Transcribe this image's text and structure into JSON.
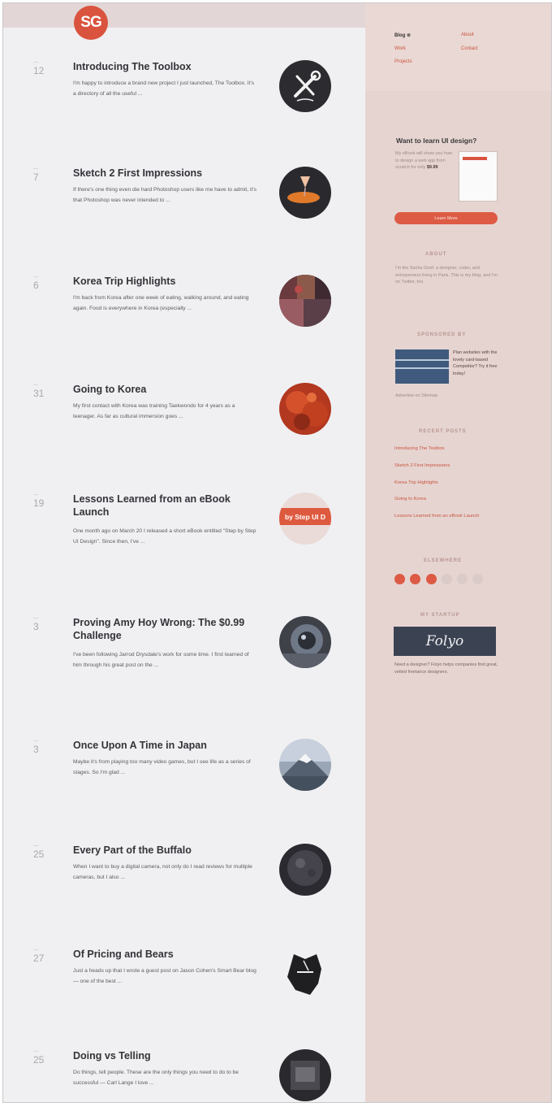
{
  "logo": {
    "text": "SG"
  },
  "posts": [
    {
      "day": "12",
      "title": "Introducing The Toolbox",
      "excerpt": "I'm happy to introduce a brand new project I just launched, The Toolbox. It's a directory of all the useful ..."
    },
    {
      "day": "7",
      "title": "Sketch 2 First Impressions",
      "excerpt": "If there's one thing even die hard Photoshop users like me have to admit, it's that Photoshop was never intended to ..."
    },
    {
      "day": "6",
      "title": "Korea Trip Highlights",
      "excerpt": "I'm back from Korea after one week of eating, walking around, and eating again. Food is everywhere in Korea (especially ..."
    },
    {
      "day": "31",
      "title": "Going to Korea",
      "excerpt": "My first contact with Korea was training Taekwondo for 4 years as a teenager. As far as cultural immersion goes ..."
    },
    {
      "day": "19",
      "title": "Lessons Learned from an eBook Launch",
      "excerpt": "One month ago on March 20 I released a short eBook entitled \"Step by Step UI Design\". Since then, I've ...",
      "thumb_text": "by Step UI D"
    },
    {
      "day": "3",
      "title": "Proving Amy Hoy Wrong: The $0.99 Challenge",
      "excerpt": "I've been following Jarrod Drysdale's work for some time. I first learned of him through his great post on the ..."
    },
    {
      "day": "3",
      "title": "Once Upon A Time in Japan",
      "excerpt": "Maybe it's from playing too many video games, but I see life as a series of stages. So I'm glad ..."
    },
    {
      "day": "25",
      "title": "Every Part of the Buffalo",
      "excerpt": "When I want to buy a digital camera, not only do I read reviews for multiple cameras, but I also ..."
    },
    {
      "day": "27",
      "title": "Of Pricing and Bears",
      "excerpt": "Just a heads up that I wrote a guest post on Jason Cohen's Smart Bear blog — one of the best ..."
    },
    {
      "day": "25",
      "title": "Doing vs Telling",
      "excerpt": "Do things, tell people. These are the only things you need to do to be successful — Carl Lange I love ..."
    }
  ],
  "sidebar": {
    "nav": [
      {
        "label": "Blog ⊗",
        "active": true
      },
      {
        "label": "About",
        "active": false
      },
      {
        "label": "Work",
        "active": false
      },
      {
        "label": "Contact",
        "active": false
      },
      {
        "label": "Projects",
        "active": false
      }
    ],
    "ebook": {
      "heading": "Want to learn UI design?",
      "text": "My eBook will show you how to design a web app from scratch for only",
      "price": "$9.99",
      "button": "Learn More"
    },
    "about": {
      "title": "ABOUT",
      "text": "I'm the Sacha Greif: a designer, coder, and entrepreneur living in Paris. This is my blog, and I'm on Twitter, too."
    },
    "sponsored": {
      "title": "SPONSORED BY",
      "text": "Plan websites with the lovely card-based Competitor? Try it free today!",
      "link": "Advertise on Sitemap"
    },
    "recent": {
      "title": "RECENT POSTS",
      "items": [
        "Introducing The Toolbox",
        "Sketch 2 First Impressions",
        "Korea Trip Highlights",
        "Going to Korea",
        "Lessons Learned from an eBook Launch"
      ]
    },
    "elsewhere": {
      "title": "ELSEWHERE"
    },
    "startup": {
      "title": "MY STARTUP",
      "brand": "Folyo",
      "text": "Need a designer? Folyo helps companies find great, vetted freelance designers."
    }
  },
  "colors": {
    "accent": "#d9533f",
    "sidebar": "#e6d4d1",
    "main": "#f0f0f3"
  }
}
